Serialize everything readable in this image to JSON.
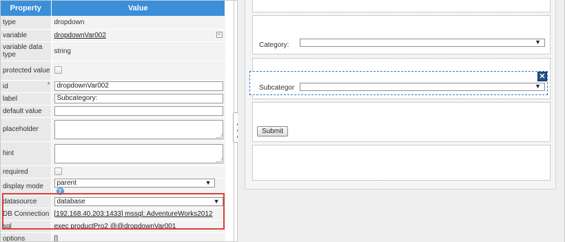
{
  "properties": {
    "header": {
      "property": "Property",
      "value": "Value"
    },
    "rows": {
      "type": {
        "label": "type",
        "value": "dropdown"
      },
      "variable": {
        "label": "variable",
        "value": "dropdownVar002"
      },
      "variable_data_type": {
        "label": "variable data type",
        "value": "string"
      },
      "protected_value": {
        "label": "protected value",
        "checked": false
      },
      "id": {
        "label": "id",
        "required_mark": "*",
        "value": "dropdownVar002"
      },
      "label": {
        "label": "label",
        "value": "Subcategory:"
      },
      "default_value": {
        "label": "default value",
        "value": ""
      },
      "placeholder": {
        "label": "placeholder",
        "value": ""
      },
      "hint": {
        "label": "hint",
        "value": ""
      },
      "required": {
        "label": "required",
        "checked": false
      },
      "display_mode": {
        "label": "display mode",
        "value": "parent",
        "help_icon": "help-icon"
      },
      "datasource": {
        "label": "datasource",
        "value": "database"
      },
      "db_connection": {
        "label": "DB Connection",
        "value": "[192.168.40.203:1433] mssql: AdventureWorks2012"
      },
      "sql": {
        "label": "sql",
        "value": "exec productPro2 @@dropdownVar001"
      },
      "options": {
        "label": "options",
        "value": "[]"
      }
    }
  },
  "form": {
    "category_label": "Category:",
    "subcategory_label": "Subcategor",
    "submit_label": "Submit",
    "close_icon": "close-icon"
  },
  "colors": {
    "header_bg": "#3b8fd8",
    "highlight_border": "#d9413a",
    "selected_border": "#3872c9",
    "close_button": "#1f4e87"
  }
}
